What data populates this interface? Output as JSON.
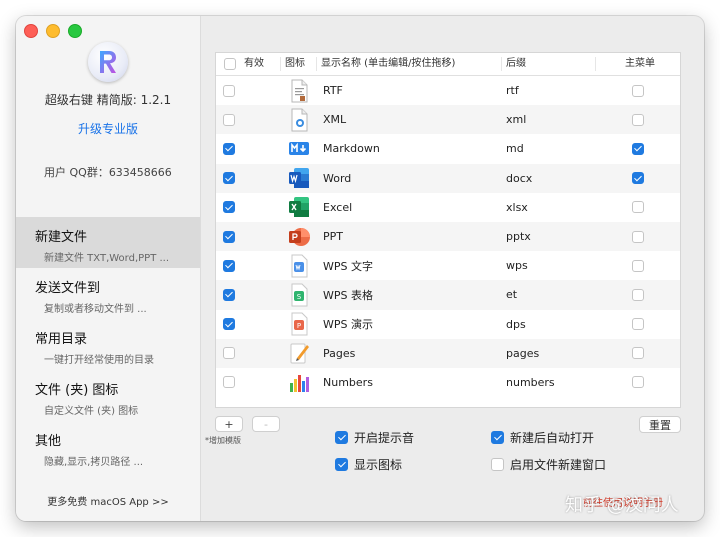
{
  "sidebar": {
    "app_title": "超级右键 精简版: 1.2.1",
    "upgrade_label": "升级专业版",
    "qq_group": "用户 QQ群：633458666",
    "items": [
      {
        "title": "新建文件",
        "subtitle": "新建文件 TXT,Word,PPT ...",
        "active": true
      },
      {
        "title": "发送文件到",
        "subtitle": "复制或者移动文件到 ...",
        "active": false
      },
      {
        "title": "常用目录",
        "subtitle": "一键打开经常使用的目录",
        "active": false
      },
      {
        "title": "文件 (夹) 图标",
        "subtitle": "自定义文件 (夹) 图标",
        "active": false
      },
      {
        "title": "其他",
        "subtitle": "隐藏,显示,拷贝路径 ...",
        "active": false
      }
    ],
    "more_apps": "更多免费 macOS App >>"
  },
  "table": {
    "headers": {
      "enabled": "有效",
      "icon": "图标",
      "name": "显示名称 (单击编辑/按住拖移)",
      "suffix": "后缀",
      "main_menu": "主菜单"
    },
    "rows": [
      {
        "enabled": false,
        "icon": "rtf-file-icon",
        "name": "RTF",
        "suffix": "rtf",
        "main_menu": false
      },
      {
        "enabled": false,
        "icon": "xml-file-icon",
        "name": "XML",
        "suffix": "xml",
        "main_menu": false
      },
      {
        "enabled": true,
        "icon": "markdown-icon",
        "name": "Markdown",
        "suffix": "md",
        "main_menu": true
      },
      {
        "enabled": true,
        "icon": "word-icon",
        "name": "Word",
        "suffix": "docx",
        "main_menu": true
      },
      {
        "enabled": true,
        "icon": "excel-icon",
        "name": "Excel",
        "suffix": "xlsx",
        "main_menu": false
      },
      {
        "enabled": true,
        "icon": "powerpoint-icon",
        "name": "PPT",
        "suffix": "pptx",
        "main_menu": false
      },
      {
        "enabled": true,
        "icon": "wps-writer-icon",
        "name": "WPS 文字",
        "suffix": "wps",
        "main_menu": false
      },
      {
        "enabled": true,
        "icon": "wps-sheet-icon",
        "name": "WPS 表格",
        "suffix": "et",
        "main_menu": false
      },
      {
        "enabled": true,
        "icon": "wps-presentation-icon",
        "name": "WPS 演示",
        "suffix": "dps",
        "main_menu": false
      },
      {
        "enabled": false,
        "icon": "pages-icon",
        "name": "Pages",
        "suffix": "pages",
        "main_menu": false
      },
      {
        "enabled": false,
        "icon": "numbers-icon",
        "name": "Numbers",
        "suffix": "numbers",
        "main_menu": false
      }
    ]
  },
  "controls": {
    "add_label": "+",
    "remove_label": "-",
    "add_hint": "*增加模版",
    "reset_label": "重置",
    "options": {
      "sound": {
        "label": "开启提示音",
        "checked": true
      },
      "auto_open": {
        "label": "新建后自动打开",
        "checked": true
      },
      "show_icon": {
        "label": "显示图标",
        "checked": true
      },
      "new_window": {
        "label": "启用文件新建窗口",
        "checked": false
      }
    },
    "footer_link": "前往使用说明手册"
  },
  "watermark": "知乎 @汶问人",
  "colors": {
    "accent": "#1f7ae0",
    "link": "#1a73e8"
  }
}
